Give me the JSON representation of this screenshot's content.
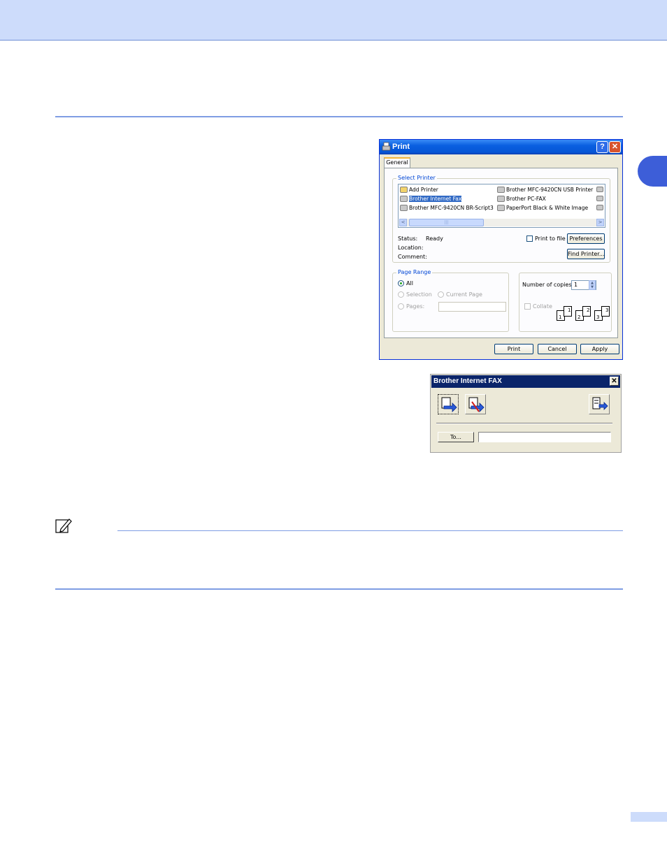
{
  "print_dialog": {
    "title": "Print",
    "help_label": "?",
    "close_label": "✕",
    "tabs": [
      {
        "label": "General"
      }
    ],
    "select_printer": {
      "label": "Select Printer",
      "printers_col1": [
        "Add Printer",
        "Brother Internet Fax",
        "Brother MFC-9420CN BR-Script3"
      ],
      "printers_col2": [
        "Brother MFC-9420CN USB Printer",
        "Brother PC-FAX",
        "PaperPort Black & White Image"
      ],
      "selected": "Brother Internet Fax",
      "scroll_thumb": "|||",
      "scroll_left": "<",
      "scroll_right": ">"
    },
    "status_label": "Status:",
    "status_value": "Ready",
    "location_label": "Location:",
    "comment_label": "Comment:",
    "print_to_file_label": "Print to file",
    "preferences_button": "Preferences",
    "find_printer_button": "Find Printer...",
    "page_range": {
      "label": "Page Range",
      "all": "All",
      "selection": "Selection",
      "current_page": "Current Page",
      "pages": "Pages:"
    },
    "number_of_copies_label": "Number of copies:",
    "copies_value": "1",
    "collate_label": "Collate",
    "collate_pages": [
      "1",
      "1",
      "2",
      "2",
      "3",
      "3"
    ],
    "buttons": {
      "print": "Print",
      "cancel": "Cancel",
      "apply": "Apply"
    }
  },
  "fax_dialog": {
    "title": "Brother Internet FAX",
    "close_label": "✕",
    "to_button": "To...",
    "to_value": ""
  },
  "colors": {
    "accent": "#3d5ed8",
    "band": "#cddcfb",
    "xp_title": "#0656d6",
    "selection": "#316ac5"
  }
}
